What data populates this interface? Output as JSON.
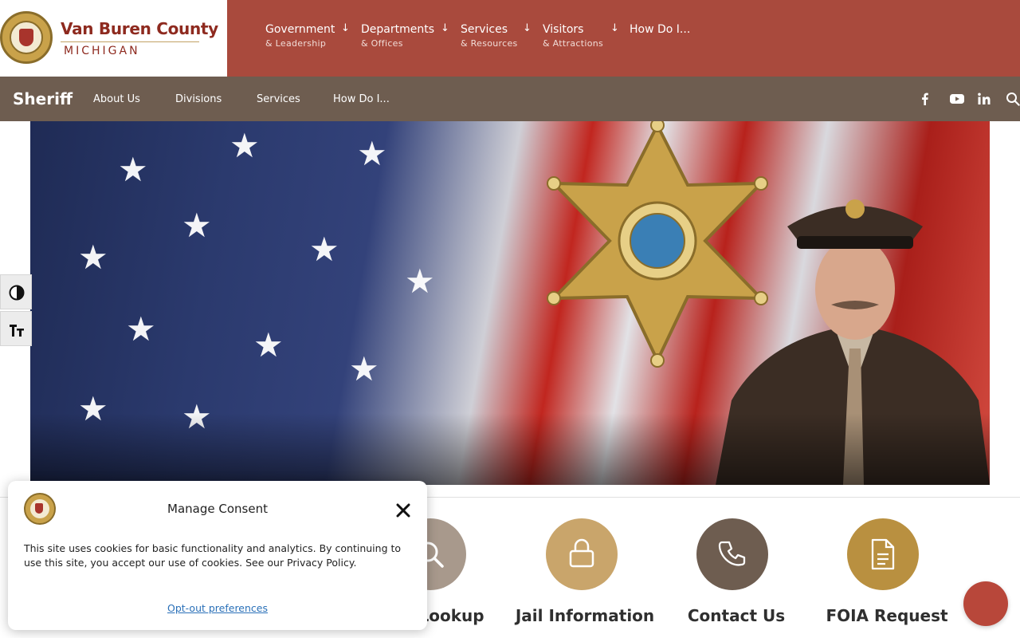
{
  "brand": {
    "title": "Van Buren County",
    "subtitle": "MICHIGAN"
  },
  "main_nav": [
    {
      "label": "Government",
      "sub": "& Leadership"
    },
    {
      "label": "Departments",
      "sub": "& Offices"
    },
    {
      "label": "Services",
      "sub": "& Resources"
    },
    {
      "label": "Visitors",
      "sub": "& Attractions"
    },
    {
      "label": "How Do I...",
      "sub": ""
    }
  ],
  "sub_nav": {
    "title": "Sheriff",
    "items": [
      "About Us",
      "Divisions",
      "Services",
      "How Do I..."
    ],
    "social_icons": [
      "facebook-icon",
      "youtube-icon",
      "linkedin-icon",
      "search-icon"
    ]
  },
  "quick_links": [
    {
      "label": "e Lookup",
      "icon": "search-icon",
      "color": "#a8998c"
    },
    {
      "label": "Jail Information",
      "icon": "lock-icon",
      "color": "#c9a56b"
    },
    {
      "label": "Contact Us",
      "icon": "phone-icon",
      "color": "#6e5d50"
    },
    {
      "label": "FOIA Request",
      "icon": "document-icon",
      "color": "#b99040"
    }
  ],
  "consent": {
    "title": "Manage Consent",
    "text": "This site uses cookies for basic functionality and analytics. By continuing to use this site, you accept our use of cookies. See our Privacy Policy.",
    "link": "Opt-out preferences"
  },
  "colors": {
    "header": "#a94a3d",
    "subnav": "#6e5d50",
    "brand_text": "#8e2a1f"
  }
}
